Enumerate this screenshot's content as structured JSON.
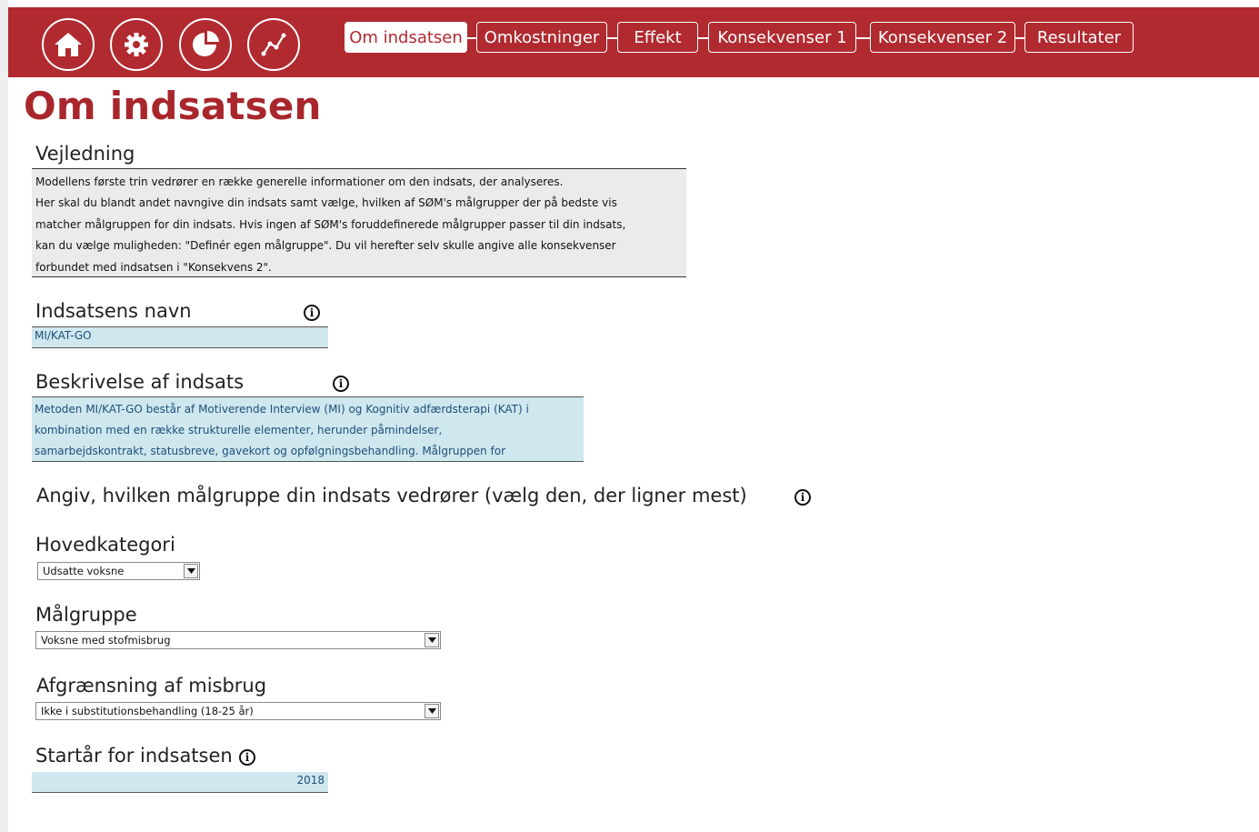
{
  "nav": {
    "icons": [
      "home-icon",
      "gear-icon",
      "pie-chart-icon",
      "line-chart-icon"
    ],
    "tabs": [
      {
        "label": "Om indsatsen",
        "active": true
      },
      {
        "label": "Omkostninger",
        "active": false
      },
      {
        "label": "Effekt",
        "active": false
      },
      {
        "label": "Konsekvenser 1",
        "active": false
      },
      {
        "label": "Konsekvenser 2",
        "active": false
      },
      {
        "label": "Resultater",
        "active": false
      }
    ]
  },
  "page": {
    "title": "Om indsatsen"
  },
  "guide": {
    "heading": "Vejledning",
    "lines": [
      "Modellens første trin vedrører en række generelle informationer om den indsats, der analyseres.",
      "Her skal du blandt andet navngive din indsats samt vælge, hvilken af SØM's målgrupper der på bedste vis",
      "matcher målgruppen for din indsats. Hvis ingen af SØM's foruddefinerede målgrupper passer til din indsats,",
      "kan du vælge muligheden: \"Definér egen målgruppe\". Du vil herefter selv skulle angive alle konsekvenser",
      "forbundet med indsatsen i \"Konsekvens 2\"."
    ]
  },
  "name_section": {
    "heading": "Indsatsens navn",
    "value": "MI/KAT-GO"
  },
  "desc_section": {
    "heading": "Beskrivelse af indsats",
    "lines": [
      "Metoden MI/KAT-GO består af Motiverende Interview (MI) og Kognitiv adfærdsterapi (KAT) i",
      "kombination med en række strukturelle elementer, herunder påmindelser,",
      "samarbejdskontrakt, statusbreve, gavekort og opfølgningsbehandling. Målgruppen for"
    ]
  },
  "target_prompt": "Angiv, hvilken målgruppe din indsats vedrører (vælg den, der ligner mest)",
  "hovedkategori": {
    "label": "Hovedkategori",
    "selected": "Udsatte voksne"
  },
  "malgruppe": {
    "label": "Målgruppe",
    "selected": "Voksne med stofmisbrug"
  },
  "afgraensning": {
    "label": "Afgrænsning af misbrug",
    "selected": "Ikke i substitutionsbehandling (18-25 år)"
  },
  "startaar": {
    "label": "Startår for indsatsen",
    "value": "2018"
  },
  "colors": {
    "brand_red": "#b02a30",
    "title_red": "#a8262c",
    "field_blue": "#cfe7ef",
    "guide_gray": "#ebebeb"
  }
}
